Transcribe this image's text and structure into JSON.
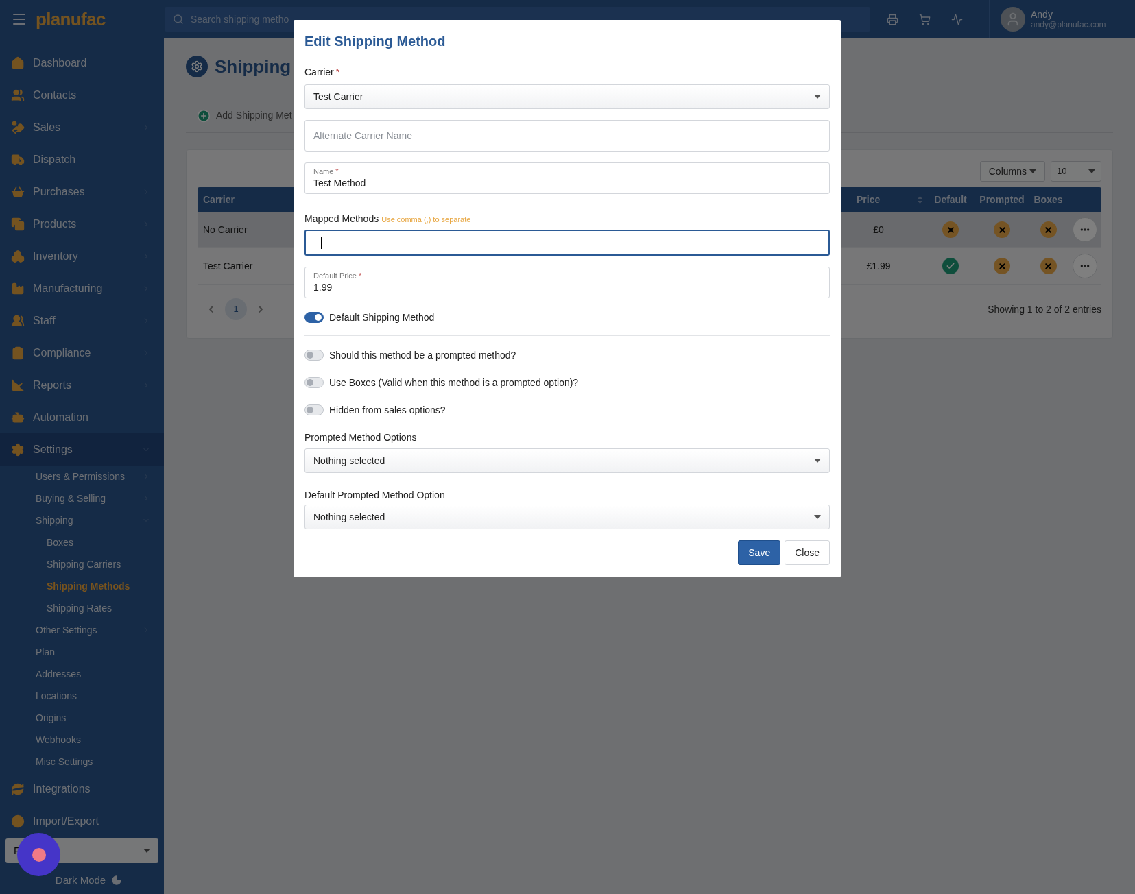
{
  "topbar": {
    "logo": "planufac",
    "search": {
      "placeholder": "Search shipping metho"
    },
    "user": {
      "name": "Andy",
      "email": "andy@planufac.com"
    }
  },
  "sidebar": {
    "items": [
      {
        "label": "Dashboard",
        "has_submenu": false,
        "selected": false
      },
      {
        "label": "Contacts",
        "has_submenu": false,
        "selected": false
      },
      {
        "label": "Sales",
        "has_submenu": true,
        "expanded": false,
        "selected": false
      },
      {
        "label": "Dispatch",
        "has_submenu": false,
        "selected": false
      },
      {
        "label": "Purchases",
        "has_submenu": true,
        "expanded": false,
        "selected": false
      },
      {
        "label": "Products",
        "has_submenu": true,
        "expanded": false,
        "selected": false
      },
      {
        "label": "Inventory",
        "has_submenu": true,
        "expanded": false,
        "selected": false
      },
      {
        "label": "Manufacturing",
        "has_submenu": true,
        "expanded": false,
        "selected": false
      },
      {
        "label": "Staff",
        "has_submenu": true,
        "expanded": false,
        "selected": false
      },
      {
        "label": "Compliance",
        "has_submenu": true,
        "expanded": false,
        "selected": false
      },
      {
        "label": "Reports",
        "has_submenu": true,
        "expanded": false,
        "selected": false
      },
      {
        "label": "Automation",
        "has_submenu": false,
        "selected": false
      },
      {
        "label": "Settings",
        "has_submenu": true,
        "expanded": true,
        "selected": false,
        "children": [
          {
            "label": "Users & Permissions",
            "has_submenu": true,
            "expanded": false,
            "selected": false
          },
          {
            "label": "Buying & Selling",
            "has_submenu": true,
            "expanded": false,
            "selected": false
          },
          {
            "label": "Shipping",
            "has_submenu": true,
            "expanded": true,
            "selected": false,
            "children": [
              {
                "label": "Boxes",
                "has_submenu": false,
                "selected": false
              },
              {
                "label": "Shipping Carriers",
                "has_submenu": false,
                "selected": false
              },
              {
                "label": "Shipping Methods",
                "has_submenu": false,
                "selected": true
              },
              {
                "label": "Shipping Rates",
                "has_submenu": false,
                "selected": false
              }
            ]
          },
          {
            "label": "Other Settings",
            "has_submenu": true,
            "expanded": false,
            "selected": false
          },
          {
            "label": "Plan",
            "has_submenu": false,
            "selected": false
          },
          {
            "label": "Addresses",
            "has_submenu": false,
            "selected": false
          },
          {
            "label": "Locations",
            "has_submenu": false,
            "selected": false
          },
          {
            "label": "Origins",
            "has_submenu": false,
            "selected": false
          },
          {
            "label": "Webhooks",
            "has_submenu": false,
            "selected": false
          },
          {
            "label": "Misc Settings",
            "has_submenu": false,
            "selected": false
          }
        ]
      },
      {
        "label": "Integrations",
        "has_submenu": false,
        "selected": false
      },
      {
        "label": "Import/Export",
        "has_submenu": false,
        "selected": false
      }
    ],
    "theme_select": {
      "value": "F"
    },
    "dark_mode": {
      "label": "Dark Mode"
    }
  },
  "page": {
    "title": "Shipping",
    "add_button": "Add Shipping Met",
    "table": {
      "columns_button": "Columns",
      "page_size": "10",
      "columns": [
        "Carrier",
        "Price",
        "Default",
        "Prompted",
        "Boxes"
      ],
      "rows": [
        {
          "carrier": "No Carrier",
          "price": "£0",
          "default": false,
          "prompted": false,
          "boxes": false,
          "hovered": true
        },
        {
          "carrier": "Test Carrier",
          "price": "£1.99",
          "default": true,
          "prompted": false,
          "boxes": false,
          "hovered": false
        }
      ],
      "pages": [
        {
          "label": "1",
          "selected": true
        }
      ],
      "info": "Showing 1 to 2 of 2 entries"
    }
  },
  "modal": {
    "title": "Edit Shipping Method",
    "carrier": {
      "label": "Carrier",
      "required_mark": "*",
      "value": "Test Carrier"
    },
    "alternate_name": {
      "placeholder": "Alternate Carrier Name"
    },
    "name": {
      "label": "Name",
      "required_mark": "*",
      "value": "Test Method"
    },
    "mapped_methods": {
      "label": "Mapped Methods",
      "hint": "Use comma (,) to separate",
      "focused": true
    },
    "default_price": {
      "label": "Default Price",
      "required_mark": "*",
      "value": "1.99"
    },
    "default_toggle": {
      "label": "Default Shipping Method",
      "on": true
    },
    "option_toggles": [
      {
        "label": "Should this method be a prompted method?",
        "on": false
      },
      {
        "label": "Use Boxes (Valid when this method is a prompted option)?",
        "on": false
      },
      {
        "label": "Hidden from sales options?",
        "on": false
      }
    ],
    "prompted_options": {
      "label": "Prompted Method Options",
      "value": "Nothing selected"
    },
    "default_prompted_option": {
      "label": "Default Prompted Method Option",
      "value": "Nothing selected"
    },
    "buttons": [
      {
        "label": "Save",
        "kind": "primary"
      },
      {
        "label": "Close",
        "kind": "secondary"
      }
    ]
  }
}
